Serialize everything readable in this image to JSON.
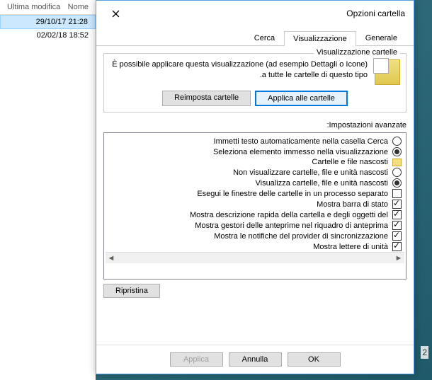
{
  "explorer": {
    "columns": {
      "name": "Nome",
      "modified": "Ultima modifica"
    },
    "rows": [
      {
        "date": "29/10/17 21:28",
        "selected": true
      },
      {
        "date": "02/02/18 18:52",
        "selected": false
      }
    ]
  },
  "dialog": {
    "title": "Opzioni cartella",
    "tabs": {
      "general": "Generale",
      "view": "Visualizzazione",
      "search": "Cerca"
    },
    "folderViews": {
      "title": "Visualizzazione cartelle",
      "desc": "È possibile applicare questa visualizzazione (ad esempio Dettagli o Icone) a tutte le cartelle di questo tipo.",
      "applyBtn": "Applica alle cartelle",
      "resetBtn": "Reimposta cartelle"
    },
    "advLabel": "Impostazioni avanzate:",
    "items": [
      {
        "type": "radio",
        "checked": false,
        "label": "Immetti testo automaticamente nella casella Cerca"
      },
      {
        "type": "radio",
        "checked": true,
        "label": "Seleziona elemento immesso nella visualizzazione"
      },
      {
        "type": "group",
        "label": "Cartelle e file nascosti"
      },
      {
        "type": "radio",
        "checked": false,
        "label": "Non visualizzare cartelle, file e unità nascosti"
      },
      {
        "type": "radio",
        "checked": true,
        "label": "Visualizza cartelle, file e unità nascosti"
      },
      {
        "type": "check",
        "checked": false,
        "label": "Esegui le finestre delle cartelle in un processo separato"
      },
      {
        "type": "check",
        "checked": true,
        "label": "Mostra barra di stato"
      },
      {
        "type": "check",
        "checked": true,
        "label": "Mostra descrizione rapida della cartella e degli oggetti del"
      },
      {
        "type": "check",
        "checked": true,
        "label": "Mostra gestori delle anteprime nel riquadro di anteprima"
      },
      {
        "type": "check",
        "checked": true,
        "label": "Mostra le notifiche del provider di sincronizzazione"
      },
      {
        "type": "check",
        "checked": true,
        "label": "Mostra lettere di unità"
      }
    ],
    "restoreBtn": "Ripristina",
    "footer": {
      "ok": "OK",
      "cancel": "Annulla",
      "apply": "Applica"
    }
  },
  "badge": "2"
}
